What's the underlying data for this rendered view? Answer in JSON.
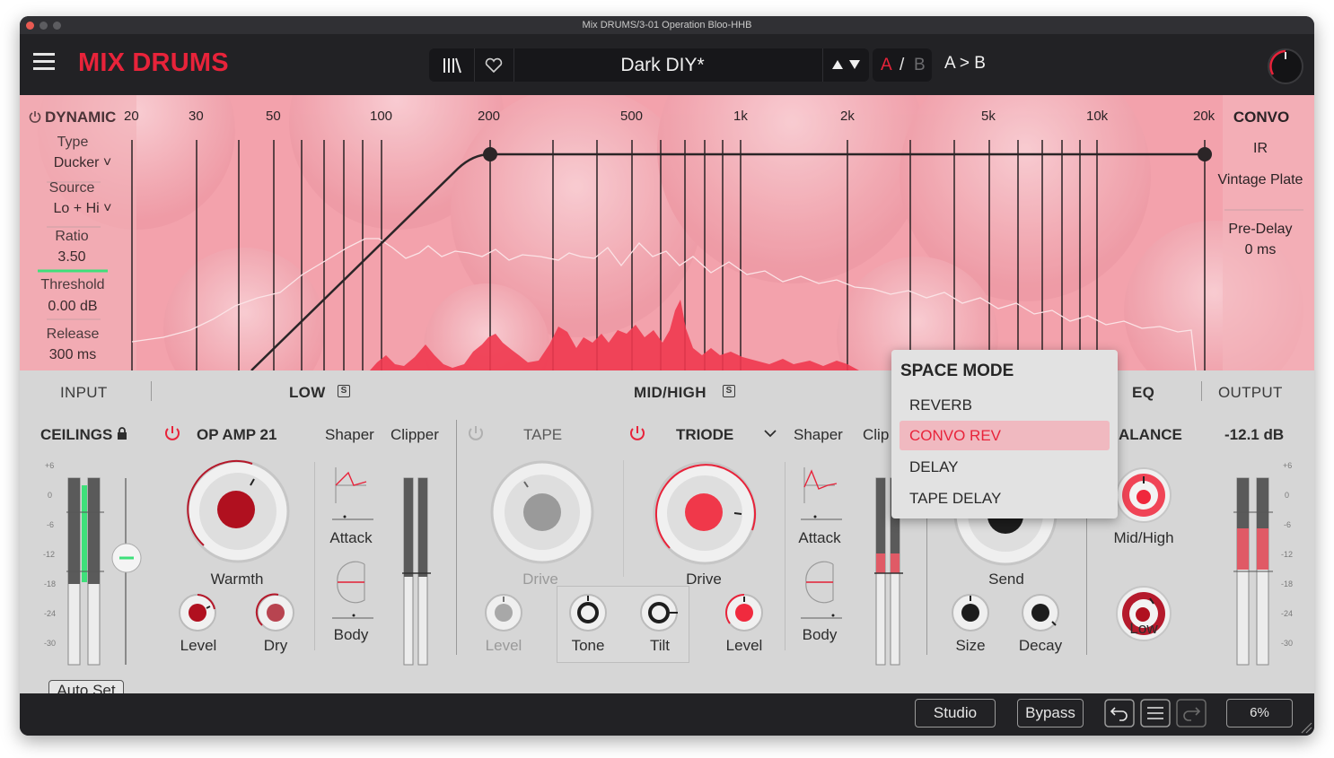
{
  "window": {
    "title": "Mix DRUMS/3-01 Operation Bloo-HHB"
  },
  "header": {
    "brand": "MIX DRUMS",
    "preset_name": "Dark DIY*",
    "ab_a": "A",
    "ab_slash": "/",
    "ab_b": "B",
    "ab_compare": "A > B"
  },
  "dynamic": {
    "title": "DYNAMIC",
    "type_label": "Type",
    "type_value": "Ducker",
    "source_label": "Source",
    "source_value": "Lo + Hi",
    "ratio_label": "Ratio",
    "ratio_value": "3.50",
    "threshold_label": "Threshold",
    "threshold_value": "0.00 dB",
    "release_label": "Release",
    "release_value": "300 ms"
  },
  "freq_labels": [
    "20",
    "30",
    "50",
    "100",
    "200",
    "500",
    "1k",
    "2k",
    "5k",
    "10k",
    "20k"
  ],
  "convo": {
    "title": "CONVO",
    "ir_label": "IR",
    "ir_value": "Vintage Plate",
    "predelay_label": "Pre-Delay",
    "predelay_value": "0 ms"
  },
  "sections": {
    "input": "INPUT",
    "low": "LOW",
    "mid_high": "MID/HIGH",
    "eq": "EQ",
    "output": "OUTPUT",
    "solo": "S"
  },
  "input": {
    "ceilings": "CEILINGS",
    "ticks": [
      "+6",
      "0",
      "-6",
      "-12",
      "-18",
      "-24",
      "-30"
    ],
    "auto_set": "Auto Set"
  },
  "low": {
    "module": "OP AMP 21",
    "shaper": "Shaper",
    "clipper": "Clipper",
    "warmth": "Warmth",
    "level": "Level",
    "dry": "Dry",
    "attack": "Attack",
    "body": "Body"
  },
  "midhigh": {
    "tape": "TAPE",
    "triode": "TRIODE",
    "shaper": "Shaper",
    "clip": "Clip",
    "drive_tape": "Drive",
    "drive_triode": "Drive",
    "level_tape": "Level",
    "tone": "Tone",
    "tilt": "Tilt",
    "level_triode": "Level",
    "attack": "Attack",
    "body": "Body"
  },
  "space": {
    "send": "Send",
    "size": "Size",
    "decay": "Decay"
  },
  "eq": {
    "balance": "ALANCE",
    "midhigh": "Mid/High",
    "low": "Low"
  },
  "output": {
    "value": "-12.1 dB",
    "ticks": [
      "+6",
      "0",
      "-6",
      "-12",
      "-18",
      "-24",
      "-30"
    ]
  },
  "space_mode": {
    "title": "SPACE MODE",
    "items": [
      "REVERB",
      "CONVO REV",
      "DELAY",
      "TAPE DELAY"
    ],
    "selected": "CONVO REV"
  },
  "footer": {
    "studio": "Studio",
    "bypass": "Bypass",
    "cpu": "6%"
  },
  "colors": {
    "accent": "#e8233a",
    "panel": "#d6d6d6",
    "spectrum_bg": "#f5a3ad",
    "meter_green": "#3ee07a",
    "meter_red": "#e05a66"
  }
}
